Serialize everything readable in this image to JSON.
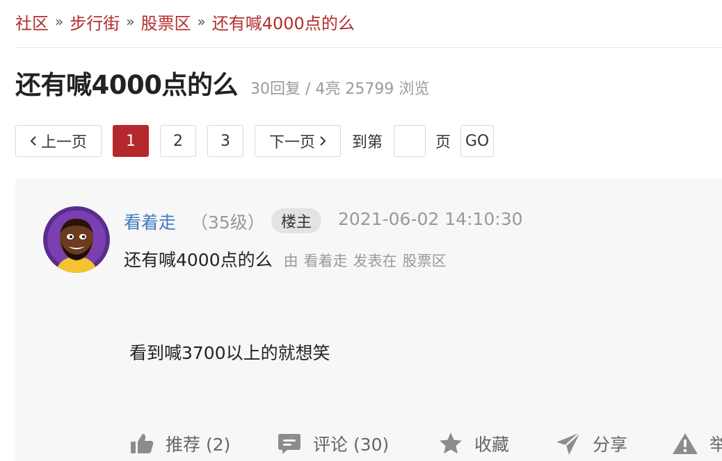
{
  "breadcrumb": {
    "items": [
      "社区",
      "步行街",
      "股票区",
      "还有喊4000点的么"
    ],
    "separator": "»"
  },
  "thread": {
    "title": "还有喊4000点的么",
    "replies": "30回复",
    "divider": "/",
    "lights": "4亮",
    "views": "25799 浏览"
  },
  "pager": {
    "prev": "上一页",
    "pages": [
      "1",
      "2",
      "3"
    ],
    "active_page": "1",
    "next": "下一页",
    "goto_prefix": "到第",
    "goto_input_value": "",
    "goto_suffix": "页",
    "go": "GO"
  },
  "post": {
    "author": "看着走",
    "level": "（35级）",
    "badge": "楼主",
    "time": "2021-06-02 14:10:30",
    "subtitle": "还有喊4000点的么",
    "meta_by": "由",
    "meta_author": "看着走",
    "meta_posted_in": "发表在",
    "meta_board": "股票区",
    "content": "看到喊3700以上的就想笑",
    "actions": {
      "recommend": "推荐 (2)",
      "comment": "评论 (30)",
      "favorite": "收藏",
      "share": "分享",
      "report": "举报"
    }
  },
  "icons": {
    "prev": "chevron-left-icon",
    "next": "chevron-right-icon",
    "recommend": "thumbs-up-icon",
    "comment": "comment-bubble-icon",
    "favorite": "star-icon",
    "share": "paper-plane-icon",
    "report": "warning-triangle-icon",
    "avatar": "user-avatar-cartoon"
  },
  "colors": {
    "link_red": "#b32c2c",
    "active_page": "#b5282b",
    "username_blue": "#3f7ac0",
    "post_bg": "#f7f7f7",
    "avatar_ring": "#5a2d8c"
  }
}
